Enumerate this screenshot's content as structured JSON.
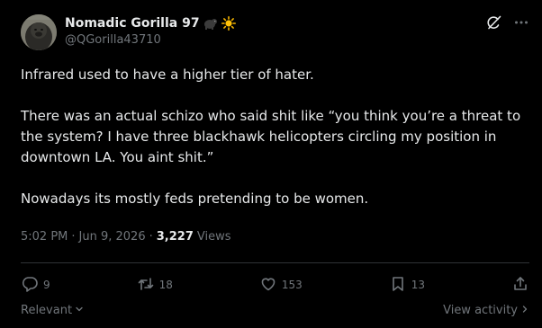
{
  "author": {
    "display_name": "Nomadic Gorilla 97",
    "handle": "@QGorilla43710",
    "emojis": [
      "gorilla-emoji",
      "sun-emoji"
    ]
  },
  "tweet": {
    "paragraphs": [
      "Infrared used to have a higher tier of hater.",
      "There was an actual schizo who said shit like “you think you’re a threat to the system? I have three blackhawk helicopters circling my position in downtown LA. You aint shit.”",
      "Nowadays its mostly feds pretending to be women."
    ]
  },
  "meta": {
    "time": "5:02 PM",
    "date": "Jun 9, 2026",
    "separator": "·",
    "views_count": "3,227",
    "views_label": "Views"
  },
  "actions": {
    "replies": "9",
    "reposts": "18",
    "likes": "153",
    "bookmarks": "13"
  },
  "footer": {
    "relevant_label": "Relevant",
    "view_activity_label": "View activity"
  },
  "icons": {
    "top": [
      "grok-icon",
      "more-icon"
    ],
    "actions": [
      "reply-icon",
      "repost-icon",
      "like-icon",
      "bookmark-icon",
      "share-icon"
    ]
  },
  "colors": {
    "background": "#000000",
    "text_primary": "#e7e9ea",
    "text_secondary": "#71767b",
    "divider": "#2f3336"
  }
}
